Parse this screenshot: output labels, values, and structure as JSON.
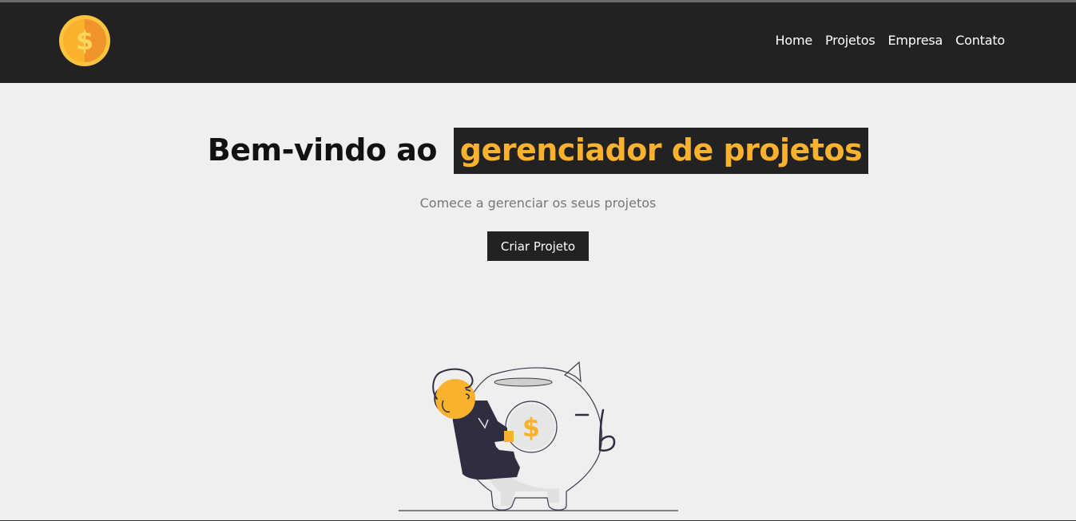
{
  "nav": {
    "links": [
      "Home",
      "Projetos",
      "Empresa",
      "Contato"
    ]
  },
  "hero": {
    "title_prefix": "Bem-vindo ao",
    "title_highlight": "gerenciador de projetos",
    "subtitle": "Comece a gerenciar os seus projetos",
    "cta_label": "Criar Projeto"
  },
  "icons": {
    "logo": "coin-dollar-icon",
    "coin": "dollar-sign",
    "illustration": "piggy-bank-person"
  },
  "colors": {
    "navbar": "#222222",
    "accent": "#f9b12e",
    "background": "#efefef",
    "button": "#222222"
  }
}
